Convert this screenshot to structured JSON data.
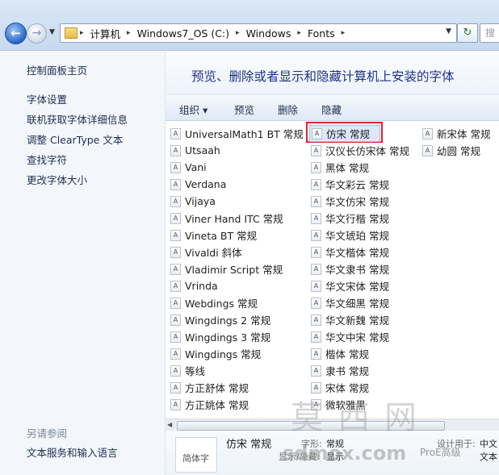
{
  "address_bar": {
    "breadcrumbs": [
      "计算机",
      "Windows7_OS (C:)",
      "Windows",
      "Fonts"
    ],
    "search_placeholder": "搜"
  },
  "left_pane": {
    "home": "控制面板主页",
    "links": [
      "字体设置",
      "联机获取字体详细信息",
      "调整 ClearType 文本",
      "查找字符",
      "更改字体大小"
    ],
    "see_also_title": "另请参阅",
    "see_also_link": "文本服务和输入语言"
  },
  "header": {
    "title": "预览、删除或者显示和隐藏计算机上安装的字体"
  },
  "toolbar": {
    "organize": "组织 ▾",
    "preview": "预览",
    "delete": "删除",
    "hide": "隐藏"
  },
  "fonts": {
    "col1": [
      "UniversalMath1 BT 常规",
      "Utsaah",
      "Vani",
      "Verdana",
      "Vijaya",
      "Viner Hand ITC 常规",
      "Vineta BT 常规",
      "Vivaldi 斜体",
      "Vladimir Script 常规",
      "Vrinda",
      "Webdings 常规",
      "Wingdings 2 常规",
      "Wingdings 3 常规",
      "Wingdings 常规",
      "等线",
      "方正舒体 常规",
      "方正姚体 常规"
    ],
    "col2": [
      "仿宋 常规",
      "汉仪长仿宋体 常规",
      "黑体 常规",
      "华文彩云 常规",
      "华文仿宋 常规",
      "华文行楷 常规",
      "华文琥珀 常规",
      "华文楷体 常规",
      "华文隶书 常规",
      "华文宋体 常规",
      "华文细黑 常规",
      "华文新魏 常规",
      "华文中宋 常规",
      "楷体 常规",
      "隶书 常规",
      "宋体 常规",
      "微软雅黑"
    ],
    "col3": [
      "新宋体 常规",
      "幼圆 常规"
    ]
  },
  "details": {
    "preview_text": "简体字",
    "name": "仿宋 常规",
    "form_label": "字形:",
    "form_value": "常规",
    "show_label": "显示/隐藏:",
    "show_value": "显示",
    "designed_label": "设计用于:",
    "designed_value": "中文",
    "category_value": "文本"
  },
  "watermark": {
    "brand": "莫西网",
    "url": "sdmox.com",
    "tag": "ProE高级"
  }
}
